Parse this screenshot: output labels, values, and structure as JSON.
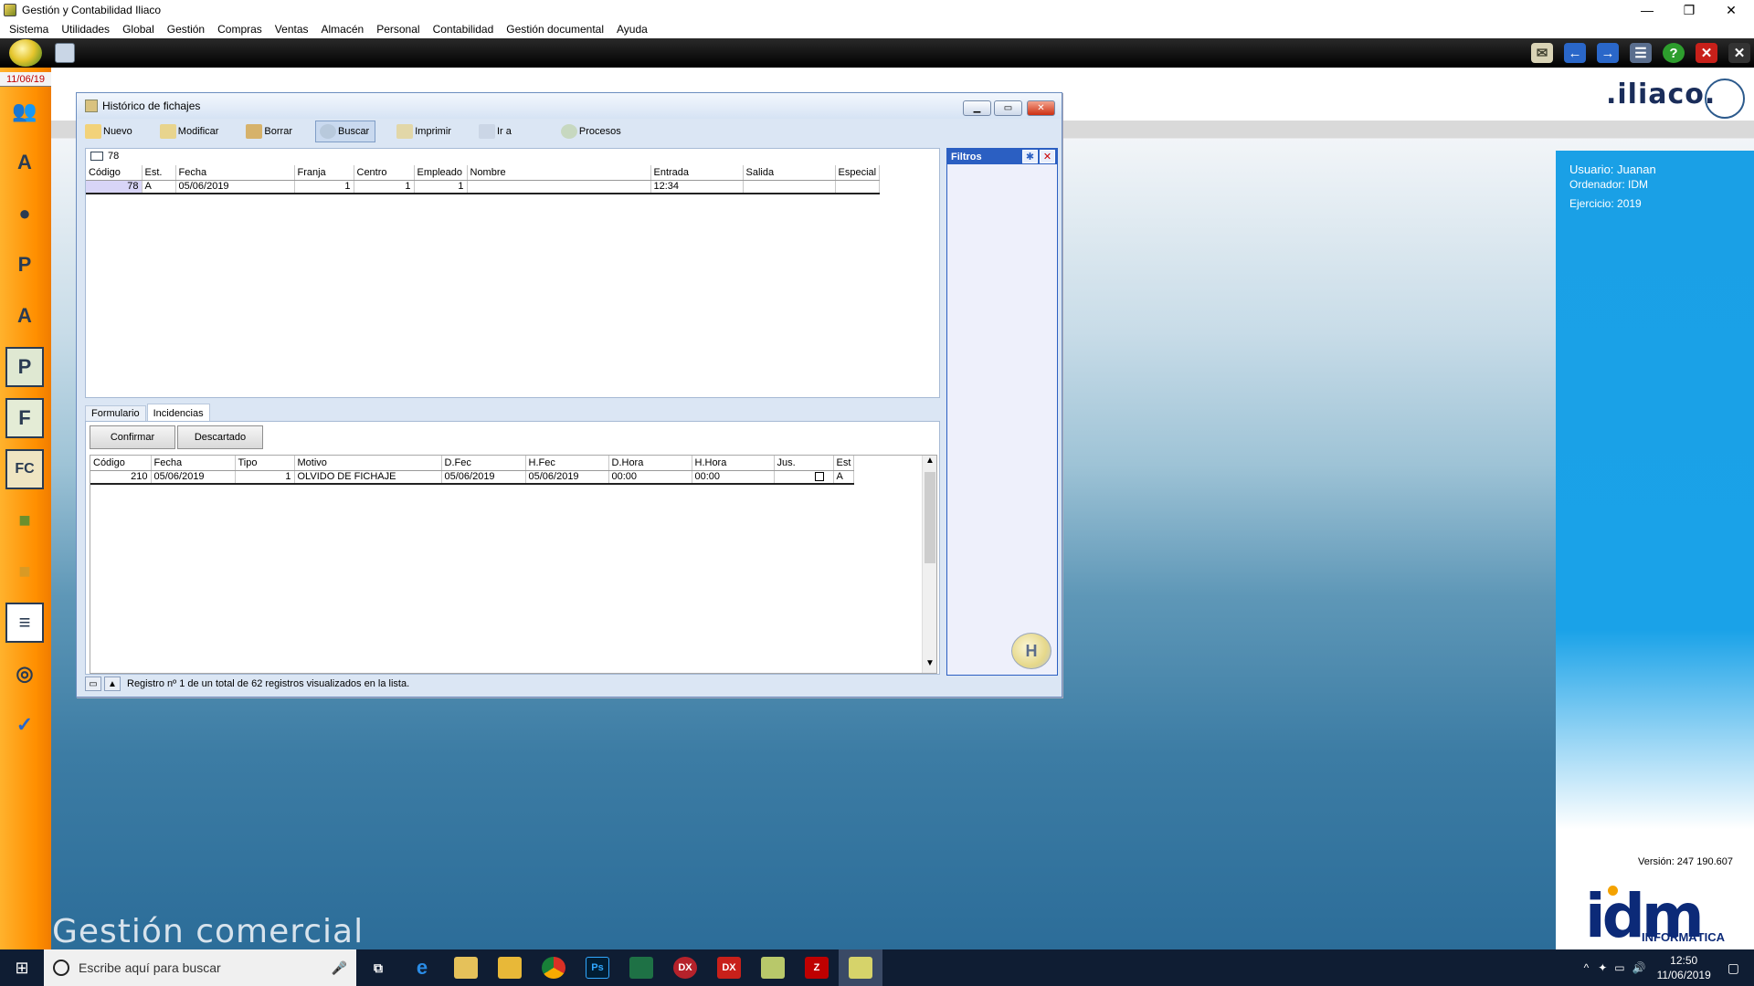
{
  "app": {
    "title": "Gestión y Contabilidad Iliaco",
    "menu": [
      "Sistema",
      "Utilidades",
      "Global",
      "Gestión",
      "Compras",
      "Ventas",
      "Almacén",
      "Personal",
      "Contabilidad",
      "Gestión documental",
      "Ayuda"
    ],
    "window_controls": {
      "minimize": "—",
      "restore": "❐",
      "close": "✕"
    }
  },
  "sidebar": {
    "date": "11/06/19",
    "icons": [
      "users-icon",
      "letter-a-icon",
      "person-icon",
      "person-p-icon",
      "person-a-icon",
      "letter-p-icon",
      "letter-f-icon",
      "letter-fc-icon",
      "bag-icon",
      "bag-open-icon",
      "list-icon",
      "disc-icon",
      "globe-check-icon"
    ]
  },
  "desktop": {
    "ghost_text": "Gestión comercial",
    "logo_text": ".iliaco."
  },
  "info": {
    "usuario": "Usuario: Juanan",
    "ordenador": "Ordenador: IDM",
    "ejercicio": "Ejercicio: 2019",
    "version": "Versión: 247 190.607",
    "brand": "idm",
    "brand_sub": "INFORMÁTICA"
  },
  "window": {
    "title": "Histórico de fichajes",
    "toolbar": [
      "Nuevo",
      "Modificar",
      "Borrar",
      "Buscar",
      "Imprimir",
      "Ir a",
      "Procesos"
    ],
    "search_value": "78",
    "list": {
      "columns": [
        "Código",
        "Est.",
        "Fecha",
        "Franja",
        "Centro",
        "Empleado",
        "Nombre",
        "Entrada",
        "Salida",
        "Especial"
      ],
      "rows": [
        {
          "codigo": "78",
          "est": "A",
          "fecha": "05/06/2019",
          "franja": "1",
          "centro": "1",
          "empleado": "1",
          "nombre": "",
          "entrada": "12:34",
          "salida": "",
          "especial": ""
        }
      ]
    },
    "tabs": [
      "Formulario",
      "Incidencias"
    ],
    "buttons": {
      "confirmar": "Confirmar",
      "descartado": "Descartado"
    },
    "incidencias": {
      "columns": [
        "Código",
        "Fecha",
        "Tipo",
        "Motivo",
        "D.Fec",
        "H.Fec",
        "D.Hora",
        "H.Hora",
        "Jus.",
        "Est"
      ],
      "rows": [
        {
          "codigo": "210",
          "fecha": "05/06/2019",
          "tipo": "1",
          "motivo": "OLVIDO DE FICHAJE",
          "dfec": "05/06/2019",
          "hfec": "05/06/2019",
          "dhora": "00:00",
          "hhora": "00:00",
          "jus": "",
          "est": "A"
        }
      ]
    },
    "status": "Registro nº 1 de un total de 62 registros visualizados en la lista.",
    "filters_title": "Filtros"
  },
  "taskbar": {
    "search_placeholder": "Escribe aquí para buscar",
    "time": "12:50",
    "date": "11/06/2019",
    "apps": [
      "task-view-icon",
      "edge-icon",
      "mail-icon",
      "explorer-icon",
      "chrome-icon",
      "photoshop-icon",
      "excel-icon",
      "dx-icon",
      "dx2-icon",
      "iliaco-icon",
      "filezilla-icon",
      "iliaco-active-icon"
    ]
  },
  "colors": {
    "accent": "#2b5fc2",
    "sidebar": "#ff9a10",
    "info_panel": "#1aa0e6"
  }
}
